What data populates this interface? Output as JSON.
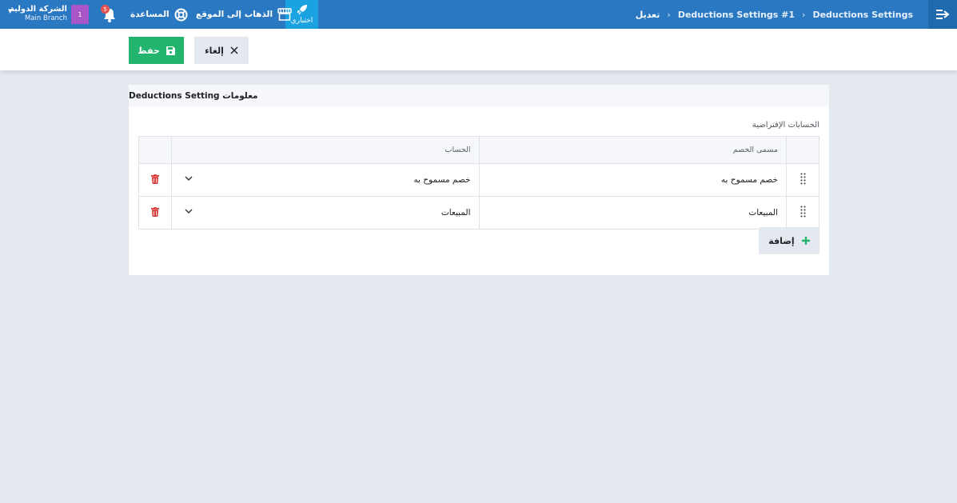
{
  "topbar": {
    "breadcrumbs": [
      {
        "label": "Deductions Settings"
      },
      {
        "label": "Deductions Settings #1"
      },
      {
        "label": "تعديل"
      }
    ],
    "trial_label": "اختباري",
    "go_to_site_label": "الذهاب إلى الموقع",
    "help_label": "المساعدة",
    "notifications_count": "5",
    "avatar_text": "1",
    "company_name": "الشركة الدولية",
    "branch_name": "Main Branch"
  },
  "actions": {
    "save_label": "حفظ",
    "cancel_label": "إلغاء"
  },
  "card": {
    "title": "معلومات Deductions Setting",
    "section_label": "الحسابات الإفتراضية",
    "columns": {
      "deduction_name": "مسمى الخصم",
      "account": "الحساب"
    },
    "rows": [
      {
        "deduction_name": "خصم مسموح به",
        "account": "خصم مسموح به"
      },
      {
        "deduction_name": "المبيعات",
        "account": "المبيعات"
      }
    ],
    "add_label": "إضافة"
  },
  "colors": {
    "topbar": "#2a78c1",
    "trial": "#1aa3e0",
    "save": "#23b46d",
    "delete": "#d93838",
    "add_plus": "#23b46d"
  }
}
